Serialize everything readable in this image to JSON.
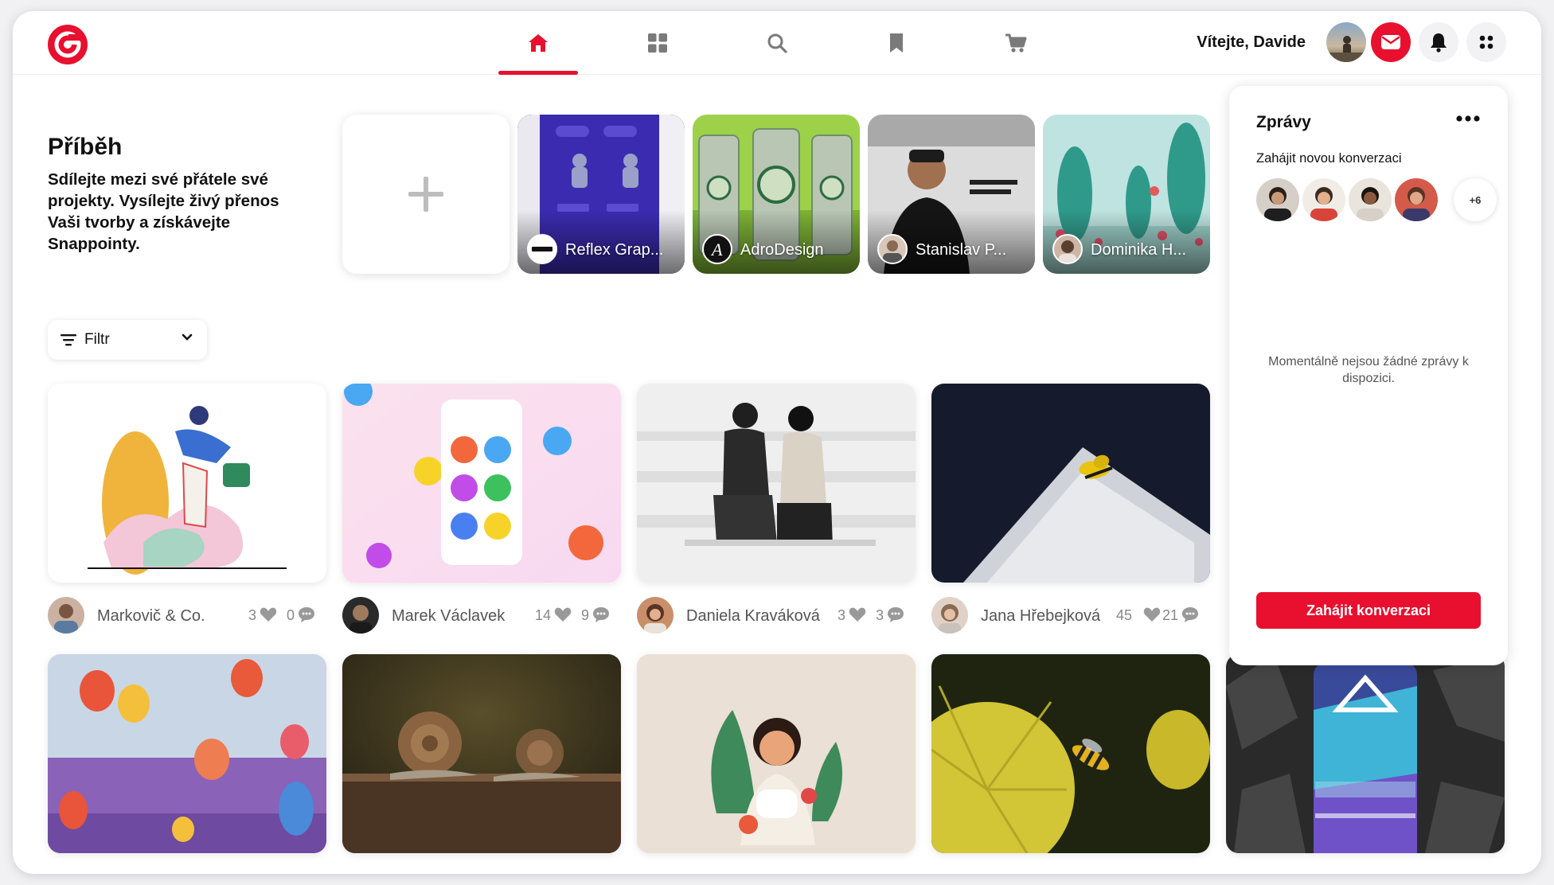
{
  "header": {
    "welcome": "Vítejte, Davide",
    "nav": [
      {
        "name": "home-icon",
        "active": true
      },
      {
        "name": "grid-icon",
        "active": false
      },
      {
        "name": "search-icon",
        "active": false
      },
      {
        "name": "bookmark-icon",
        "active": false
      },
      {
        "name": "cart-icon",
        "active": false
      }
    ],
    "accent": "#e8102e"
  },
  "story": {
    "title": "Příběh",
    "description": "Sdílejte mezi své přátele své projekty. Vysílejte živý přenos Vaši tvorby a získávejte Snappointy.",
    "items": [
      {
        "name": "Reflex Grap..."
      },
      {
        "name": "AdroDesign"
      },
      {
        "name": "Stanislav P..."
      },
      {
        "name": "Dominika H..."
      }
    ]
  },
  "filter": {
    "label": "Filtr"
  },
  "cards": [
    {
      "author": "Markovič & Co.",
      "likes": "3",
      "comments": "0"
    },
    {
      "author": "Marek Václavek",
      "likes": "14",
      "comments": "9"
    },
    {
      "author": "Daniela Kraváková",
      "likes": "3",
      "comments": "3"
    },
    {
      "author": "Jana Hřebejková",
      "likes": "45",
      "comments": "21"
    }
  ],
  "panel": {
    "title": "Zprávy",
    "subtitle": "Zahájit novou konverzaci",
    "more_count": "+6",
    "empty": "Momentálně nejsou žádné zprávy k dispozici.",
    "button": "Zahájit konverzaci"
  }
}
